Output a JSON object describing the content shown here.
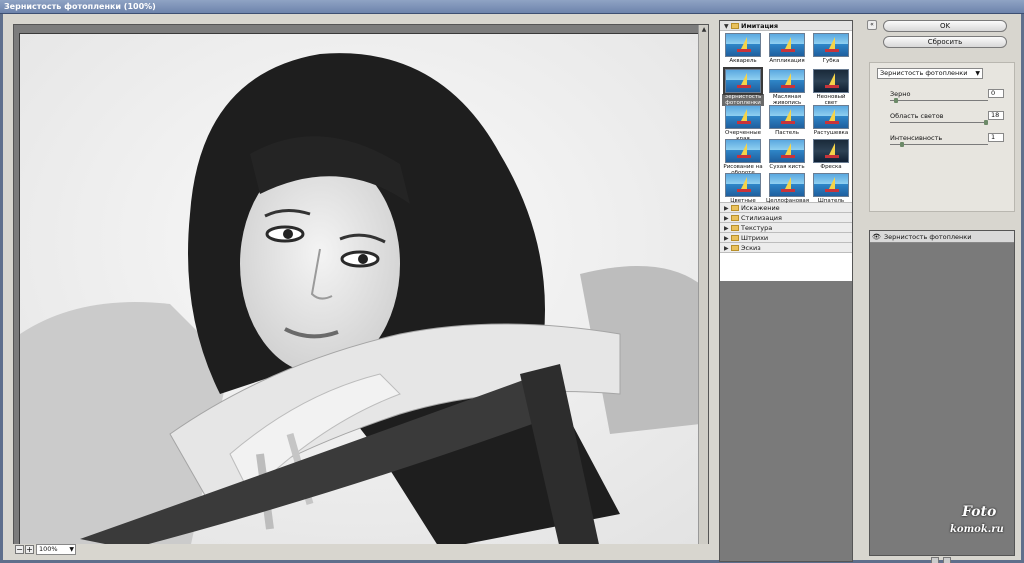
{
  "window": {
    "title": "Зернистость фотопленки (100%)"
  },
  "preview": {
    "zoom": "100%"
  },
  "filter_gallery": {
    "open_category": {
      "label": "Имитация",
      "icon": "folder-icon"
    },
    "filters": [
      "Акварель",
      "Аппликация",
      "Губка",
      "Зернистость фотопленки",
      "Масляная живопись",
      "Неоновый свет",
      "Очерченные края",
      "Пастель",
      "Растушевка",
      "Рисование на обороте",
      "Сухая кисть",
      "Фреска",
      "Цветные карандаши",
      "Целлофановая упаковка",
      "Шпатель"
    ],
    "selected_filter": "Зернистость фотопленки",
    "collapsed_categories": [
      "Искажение",
      "Стилизация",
      "Текстура",
      "Штрихи",
      "Эскиз"
    ]
  },
  "buttons": {
    "ok": "OK",
    "reset": "Сбросить"
  },
  "settings": {
    "filter_select": "Зернистость фотопленки",
    "params": [
      {
        "label": "Зерно",
        "value": "0"
      },
      {
        "label": "Область светов",
        "value": "18"
      },
      {
        "label": "Интенсивность",
        "value": "1"
      }
    ]
  },
  "layers": {
    "active": "Зернистость фотопленки"
  },
  "watermark": {
    "line1": "Foto",
    "line2": "komok.ru"
  }
}
